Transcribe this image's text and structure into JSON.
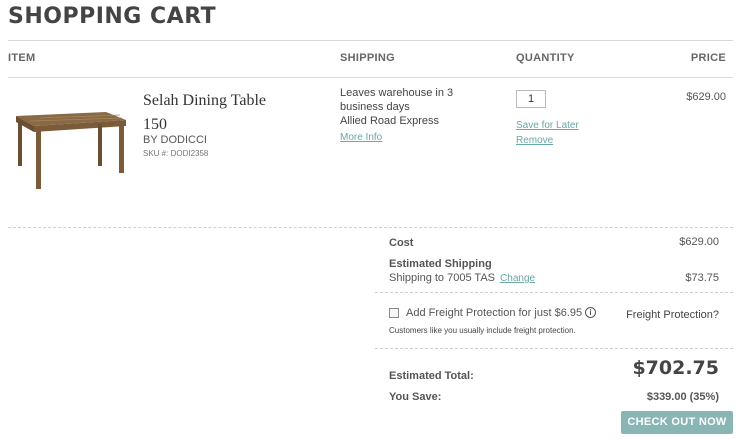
{
  "page_title": "SHOPPING CART",
  "columns": {
    "item": "ITEM",
    "shipping": "SHIPPING",
    "quantity": "QUANTITY",
    "price": "PRICE"
  },
  "item": {
    "name_line1": "Selah Dining Table",
    "name_line2": "150",
    "brand": "BY DODICCI",
    "sku": "SKU #: DODI2358",
    "shipping_line1": "Leaves warehouse in 3",
    "shipping_line2": "business days",
    "carrier": "Allied Road Express",
    "more_info": "More Info",
    "quantity": "1",
    "save_for_later": "Save for Later",
    "remove": "Remove",
    "price": "$629.00"
  },
  "summary": {
    "cost_label": "Cost",
    "cost_value": "$629.00",
    "est_shipping_label": "Estimated Shipping",
    "shipping_to": "Shipping to 7005 TAS",
    "change": "Change",
    "shipping_value": "$73.75",
    "freight_label": "Add Freight Protection for just $6.95",
    "freight_note": "Customers like you usually include freight protection.",
    "freight_question": "Freight Protection?",
    "info_glyph": "i",
    "total_label": "Estimated Total:",
    "total_value": "$702.75",
    "you_save_label": "You Save:",
    "you_save_value": "$339.00 (35%)",
    "checkout": "CHECK OUT NOW"
  },
  "icons": {
    "info": "info-circle-icon",
    "checkbox": "checkbox-icon"
  },
  "colors": {
    "accent": "#6aa7a7",
    "button": "#89b5b5",
    "text": "#555555"
  }
}
